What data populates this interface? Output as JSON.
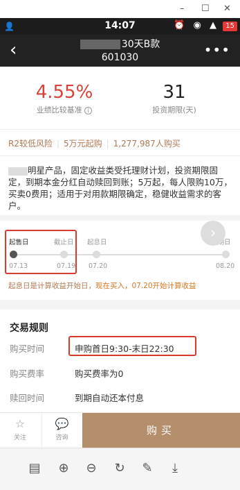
{
  "window": {
    "minimize": "–",
    "restore": "☐",
    "close": "✕"
  },
  "status_bar": {
    "time": "14:07",
    "battery": "15",
    "left_icon": "person-icon",
    "icons_text": "⏰ ◉ ▲"
  },
  "nav": {
    "title_suffix": "30天B款",
    "code": "601030",
    "back": "‹",
    "more": "•••"
  },
  "hero": {
    "rate": "4.55%",
    "rate_label": "业绩比较基准",
    "info": "i",
    "period": "31",
    "period_label": "投资期限(天)",
    "rate_color": "#d9423a"
  },
  "tags": [
    "R2较低风险",
    "5万元起购",
    "1,277,987人购买"
  ],
  "description": "明星产品，固定收益类受托理财计划，投资期限固定，到期本金分红自动赎回到账；5万起，每人限购10万，买卖0费用；适用于对用款期限确定，稳健收益需求的客户。",
  "timeline": {
    "labels": [
      "起售日",
      "截止日",
      "起息日",
      "到期日"
    ],
    "dates": [
      "07.13",
      "07.19",
      "07.20",
      "08.20"
    ],
    "next": "›"
  },
  "note": {
    "prefix": "起息日是计算收益开始日，",
    "highlight": "现在买入，07.20开始计算收益"
  },
  "rules": {
    "title": "交易规则",
    "rows": [
      {
        "label": "购买时间",
        "value": "申购首日9:30-末日22:30"
      },
      {
        "label": "购买费率",
        "value": "购买费率为0"
      },
      {
        "label": "赎回时间",
        "value": "到期自动还本付息"
      }
    ]
  },
  "bottom": {
    "follow_icon": "☆",
    "follow_label": "关注",
    "consult_icon": "💬",
    "consult_label": "咨询",
    "buy": "购买",
    "accent": "#b58e6b"
  },
  "pdf_toolbar": {
    "icons": [
      "pages-icon",
      "zoom-in-icon",
      "zoom-out-icon",
      "rotate-icon",
      "edit-icon",
      "download-icon"
    ],
    "glyphs": [
      "▤",
      "⊕",
      "⊖",
      "↻",
      "✎",
      "⤓"
    ]
  }
}
